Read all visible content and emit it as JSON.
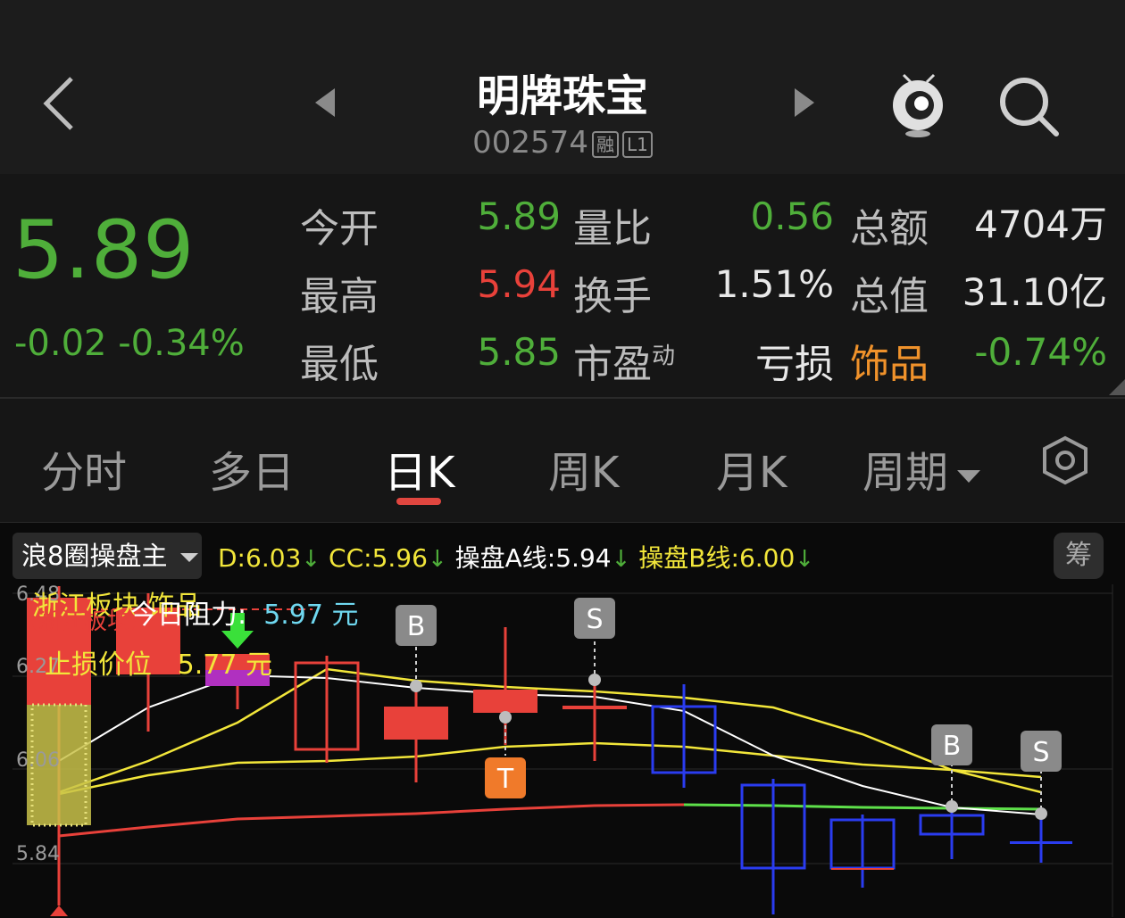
{
  "header": {
    "stock_name": "明牌珠宝",
    "stock_code": "002574",
    "tag_margin": "融",
    "tag_level": "L1"
  },
  "quote": {
    "price": "5.89",
    "change": "-0.02",
    "change_pct": "-0.34%",
    "fields": [
      {
        "label": "今开",
        "value": "5.89",
        "color": "#4fae3a"
      },
      {
        "label": "最高",
        "value": "5.94",
        "color": "#e8413a"
      },
      {
        "label": "最低",
        "value": "5.85",
        "color": "#4fae3a"
      },
      {
        "label": "量比",
        "value": "0.56",
        "color": "#4fae3a"
      },
      {
        "label": "换手",
        "value": "1.51%",
        "color": "#e8e8e8"
      },
      {
        "label": "市盈",
        "label_sup": "动",
        "value": "亏损",
        "color": "#e8e8e8"
      },
      {
        "label": "总额",
        "value": "4704万",
        "color": "#e8e8e8"
      },
      {
        "label": "总值",
        "value": "31.10亿",
        "color": "#e8e8e8"
      },
      {
        "label": "饰品",
        "value": "-0.74%",
        "color": "#4fae3a"
      }
    ]
  },
  "tabs": [
    "分时",
    "多日",
    "日K",
    "周K",
    "月K",
    "周期"
  ],
  "active_tab": "日K",
  "indicator": {
    "name": "浪8圈操盘主",
    "values": [
      {
        "label": "D:",
        "value": "6.03",
        "color": "#f2e63a"
      },
      {
        "label": "CC:",
        "value": "5.96",
        "color": "#f2e63a"
      },
      {
        "label": "操盘A线:",
        "value": "5.94",
        "color": "#ffffff"
      },
      {
        "label": "操盘B线:",
        "value": "6.00",
        "color": "#f2e63a"
      }
    ],
    "chip_label": "筹"
  },
  "chart_annotations": {
    "sector_text": "浙江板块 饰品",
    "bracket_text": "【浙江板块】",
    "resistance_text": "今日阻力:",
    "resistance_value": "5.97 元",
    "stoploss_text": "止损价位",
    "stoploss_value": "5.77 元"
  },
  "chart_data": {
    "type": "candlestick",
    "y_ticks": [
      "6.48",
      "6.27",
      "6.06",
      "5.84"
    ],
    "signals": [
      "B",
      "S",
      "T",
      "B",
      "S"
    ],
    "candles": [
      {
        "open": 6.0,
        "close": 6.3,
        "high": 6.48,
        "low": 5.62,
        "dir": "up"
      },
      {
        "open": 6.27,
        "close": 6.33,
        "high": 6.33,
        "low": 6.12,
        "dir": "up"
      },
      {
        "open": 6.25,
        "close": 6.22,
        "high": 6.27,
        "low": 6.18,
        "dir": "up"
      },
      {
        "open": 6.07,
        "close": 6.25,
        "high": 6.26,
        "low": 6.05,
        "dir": "up"
      },
      {
        "open": 6.09,
        "close": 6.16,
        "high": 6.16,
        "low": 6.01,
        "dir": "down"
      },
      {
        "open": 6.17,
        "close": 6.23,
        "high": 6.31,
        "low": 6.08,
        "dir": "up"
      },
      {
        "open": 6.18,
        "close": 6.18,
        "high": 6.23,
        "low": 6.05,
        "dir": "down"
      },
      {
        "open": 6.18,
        "close": 6.03,
        "high": 6.21,
        "low": 5.98,
        "dir": "down"
      },
      {
        "open": 6.0,
        "close": 5.82,
        "high": 6.0,
        "low": 5.72,
        "dir": "down"
      },
      {
        "open": 5.88,
        "close": 5.82,
        "high": 5.88,
        "low": 5.78,
        "dir": "down"
      },
      {
        "open": 5.92,
        "close": 5.88,
        "high": 5.92,
        "low": 5.85,
        "dir": "down"
      },
      {
        "open": 5.89,
        "close": 5.89,
        "high": 5.94,
        "low": 5.85,
        "dir": "down"
      }
    ]
  }
}
